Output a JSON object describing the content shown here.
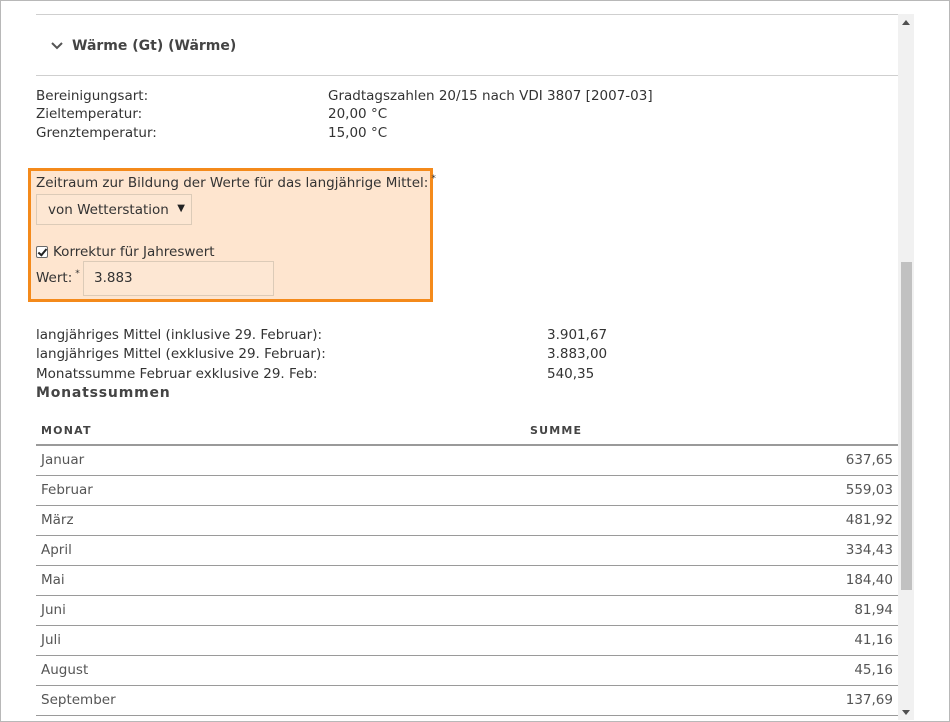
{
  "section": {
    "title": "Wärme (Gt) (Wärme)"
  },
  "info": [
    {
      "label": "Bereinigungsart:",
      "value": "Gradtagszahlen 20/15 nach VDI 3807 [2007-03]"
    },
    {
      "label": "Zieltemperatur:",
      "value": "20,00 °C"
    },
    {
      "label": "Grenztemperatur:",
      "value": "15,00 °C"
    }
  ],
  "form": {
    "period_label": "Zeitraum zur Bildung der Werte für das langjährige Mittel:",
    "required_marker": "*",
    "period_select_value": "von Wetterstation",
    "correction_label": "Korrektur für Jahreswert",
    "correction_checked": true,
    "wert_label": "Wert:",
    "wert_value": "3.883",
    "highlight_color": "#f48a1b"
  },
  "means": [
    {
      "label": "langjähriges Mittel (inklusive 29. Februar):",
      "value": "3.901,67"
    },
    {
      "label": "langjähriges Mittel (exklusive 29. Februar):",
      "value": "3.883,00"
    },
    {
      "label": "Monatssumme Februar exklusive 29. Feb:",
      "value": "540,35"
    }
  ],
  "monthly": {
    "title": "Monatssummen",
    "col_month": "MONAT",
    "col_sum": "SUMME",
    "rows": [
      {
        "month": "Januar",
        "sum": "637,65"
      },
      {
        "month": "Februar",
        "sum": "559,03"
      },
      {
        "month": "März",
        "sum": "481,92"
      },
      {
        "month": "April",
        "sum": "334,43"
      },
      {
        "month": "Mai",
        "sum": "184,40"
      },
      {
        "month": "Juni",
        "sum": "81,94"
      },
      {
        "month": "Juli",
        "sum": "41,16"
      },
      {
        "month": "August",
        "sum": "45,16"
      },
      {
        "month": "September",
        "sum": "137,69"
      }
    ]
  },
  "icons": {
    "collapse": "chevron-down-icon",
    "dropdown": "caret-down-icon",
    "check": "checkbox-checked-icon"
  }
}
